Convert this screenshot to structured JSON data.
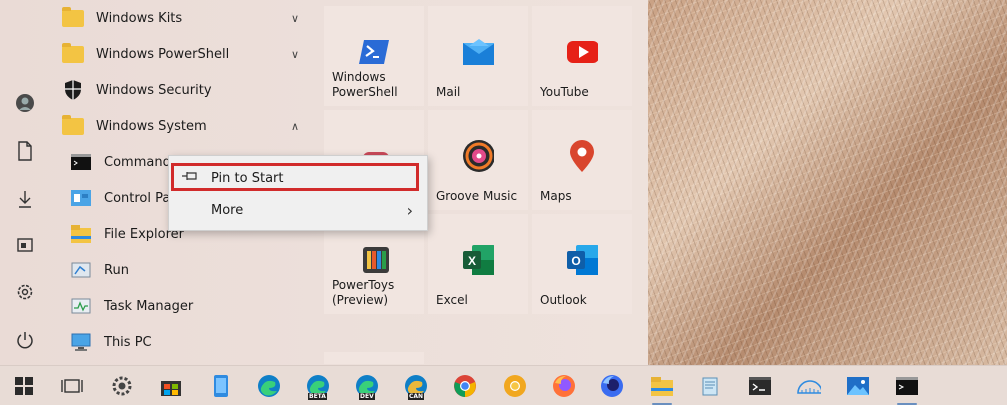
{
  "app_list": [
    {
      "label": "Windows Kits",
      "icon": "folder-icon",
      "expandable": true,
      "expanded": false
    },
    {
      "label": "Windows PowerShell",
      "icon": "folder-icon",
      "expandable": true,
      "expanded": false
    },
    {
      "label": "Windows Security",
      "icon": "shield-icon",
      "expandable": false
    },
    {
      "label": "Windows System",
      "icon": "folder-icon",
      "expandable": true,
      "expanded": true
    }
  ],
  "sub_items": [
    {
      "label": "Command P",
      "icon": "command-prompt-icon"
    },
    {
      "label": "Control Pane",
      "icon": "control-panel-icon"
    },
    {
      "label": "File Explorer",
      "icon": "file-explorer-icon"
    },
    {
      "label": "Run",
      "icon": "run-icon"
    },
    {
      "label": "Task Manager",
      "icon": "task-manager-icon"
    },
    {
      "label": "This PC",
      "icon": "this-pc-icon"
    }
  ],
  "tiles": [
    {
      "label": "Windows PowerShell",
      "icon": "powershell-icon",
      "color": "#2a6bd6"
    },
    {
      "label": "Mail",
      "icon": "mail-icon",
      "color": "#1a7fd8"
    },
    {
      "label": "YouTube",
      "icon": "youtube-icon",
      "color": "#e62117"
    },
    {
      "label": "",
      "icon": "unknown-app-icon",
      "color": "#c94a5a"
    },
    {
      "label": "Groove Music",
      "icon": "groove-music-icon",
      "color": "#f07a28"
    },
    {
      "label": "Maps",
      "icon": "maps-icon",
      "color": "#d9452d"
    },
    {
      "label": "PowerToys (Preview)",
      "icon": "powertoys-icon",
      "color": "#3b3b3b"
    },
    {
      "label": "Excel",
      "icon": "excel-icon",
      "color": "#1e7145"
    },
    {
      "label": "Outlook",
      "icon": "outlook-icon",
      "color": "#0f6cbd"
    }
  ],
  "context_menu": {
    "items": [
      {
        "label": "Pin to Start",
        "icon": "pin-icon"
      },
      {
        "label": "More",
        "icon": "chevron-right-icon"
      }
    ],
    "highlight_color": "#d12b2b"
  },
  "left_rail": [
    "user-icon",
    "document-icon",
    "download-icon",
    "gallery-icon",
    "settings-icon",
    "power-icon"
  ],
  "taskbar": [
    "windows-start-icon",
    "task-view-icon",
    "settings-icon",
    "store-icon",
    "phone-icon",
    "edge-icon",
    "edge-beta-icon",
    "edge-dev-icon",
    "edge-canary-icon",
    "chrome-icon",
    "chrome-canary-icon",
    "firefox-icon",
    "firefox-nightly-icon",
    "file-explorer-icon",
    "notepad-icon",
    "terminal-icon",
    "ruler-icon",
    "photos-icon",
    "command-prompt-icon"
  ],
  "beta_badge": "BETA",
  "dev_badge": "DEV",
  "can_badge": "CAN"
}
